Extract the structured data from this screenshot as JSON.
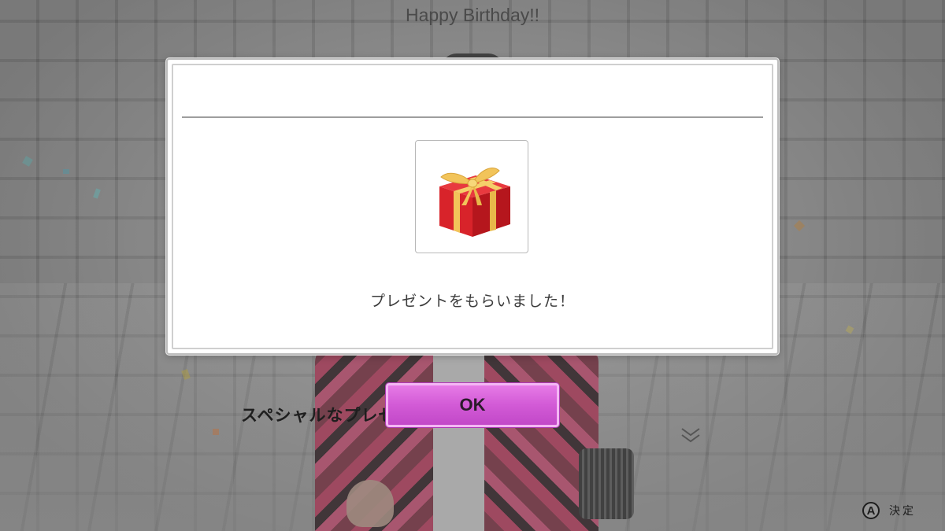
{
  "modal": {
    "title": "Happy Birthday!!",
    "message": "プレゼントをもらいました！",
    "item_icon": "gift-box-icon"
  },
  "ok_button": {
    "label": "OK"
  },
  "dialogue": {
    "text": "スペシャルなプレゼントをもらいました！"
  },
  "hint": {
    "button_glyph": "A",
    "label": "決定"
  },
  "colors": {
    "ok_button": "#d65ad8",
    "ok_border": "#f4b6f4",
    "gift_red": "#d8232a",
    "gift_ribbon": "#f2c45a",
    "modal_background": "#ffffff"
  }
}
